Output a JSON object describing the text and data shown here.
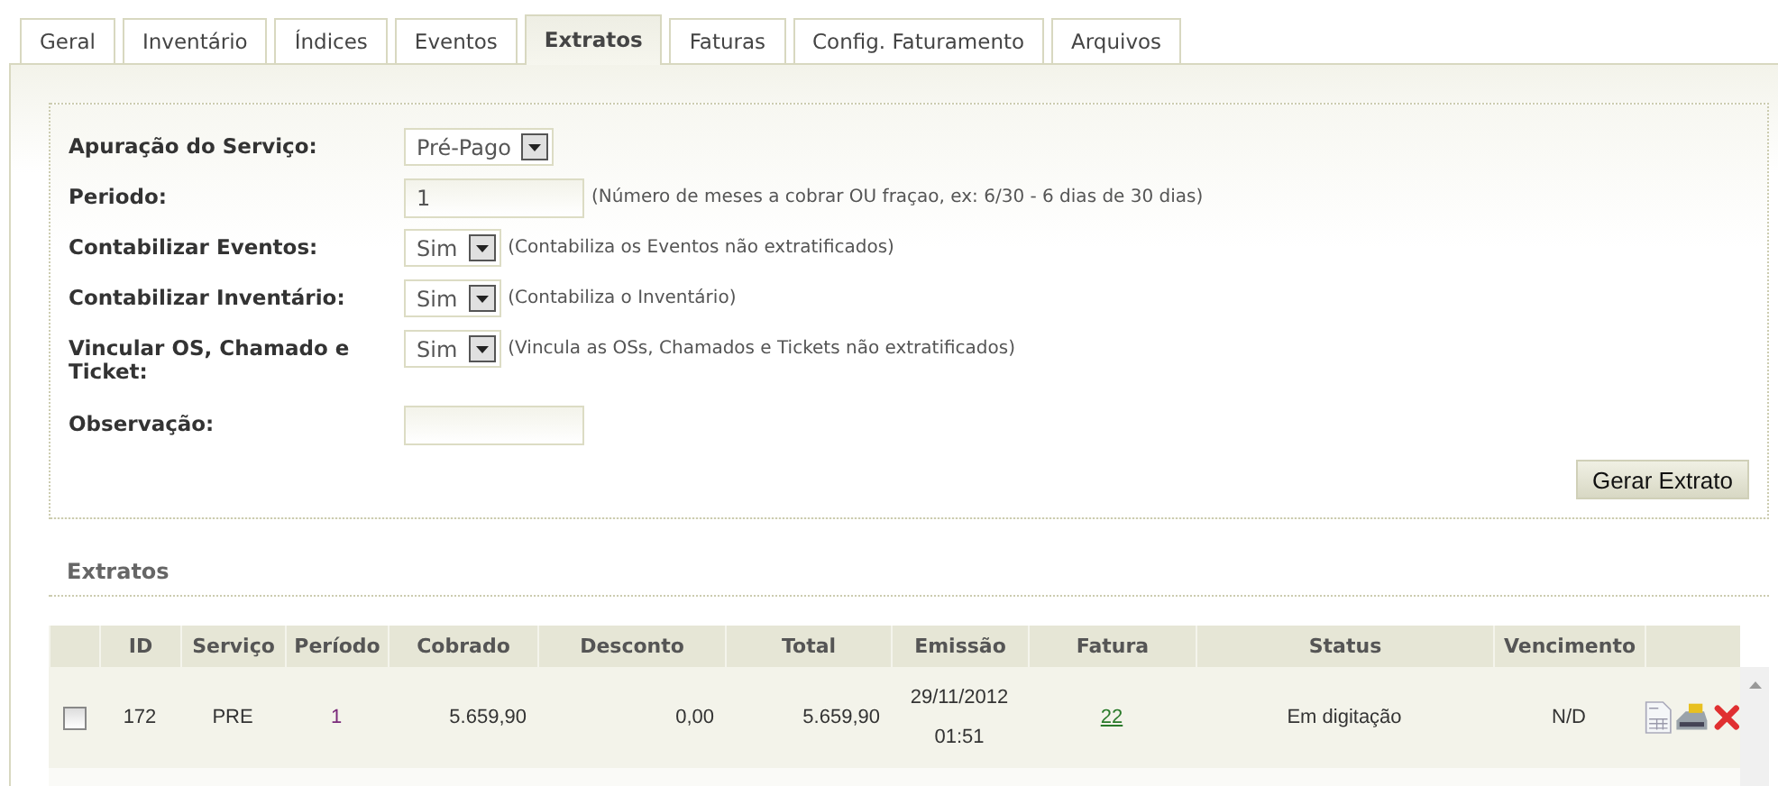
{
  "tabs": [
    {
      "label": "Geral",
      "selected": false
    },
    {
      "label": "Inventário",
      "selected": false
    },
    {
      "label": "Índices",
      "selected": false
    },
    {
      "label": "Eventos",
      "selected": false
    },
    {
      "label": "Extratos",
      "selected": true
    },
    {
      "label": "Faturas",
      "selected": false
    },
    {
      "label": "Config. Faturamento",
      "selected": false
    },
    {
      "label": "Arquivos",
      "selected": false
    }
  ],
  "form": {
    "fields": [
      {
        "kind": "select",
        "label": "Apuração do Serviço:",
        "value": "Pré-Pago"
      },
      {
        "kind": "input",
        "label": "Periodo:",
        "value": "1",
        "hint": "(Número de meses a cobrar OU fraçao, ex: 6/30 - 6 dias de 30 dias)"
      },
      {
        "kind": "select",
        "label": "Contabilizar Eventos:",
        "value": "Sim",
        "hint": "(Contabiliza os Eventos não extratificados)"
      },
      {
        "kind": "select",
        "label": "Contabilizar Inventário:",
        "value": "Sim",
        "hint": "(Contabiliza o Inventário)"
      },
      {
        "kind": "select",
        "label": "Vincular OS, Chamado e Ticket:",
        "value": "Sim",
        "hint": "(Vincula as OSs, Chamados e Tickets não extratificados)"
      },
      {
        "kind": "input",
        "label": "Observação:"
      }
    ],
    "button": "Gerar Extrato"
  },
  "section_title": "Extratos",
  "table": {
    "columns": [
      "ID",
      "Serviço",
      "Período",
      "Cobrado",
      "Desconto",
      "Total",
      "Emissão",
      "Fatura",
      "Status",
      "Vencimento"
    ],
    "rows": [
      {
        "checked": false,
        "id": "172",
        "servico": "PRE",
        "periodo": "1",
        "cobrado": "5.659,90",
        "desconto": "0,00",
        "total": "5.659,90",
        "emissao_date": "29/11/2012",
        "emissao_time": "01:51",
        "fatura": "22",
        "status": "Em digitação",
        "vencimento": "N/D"
      }
    ]
  }
}
